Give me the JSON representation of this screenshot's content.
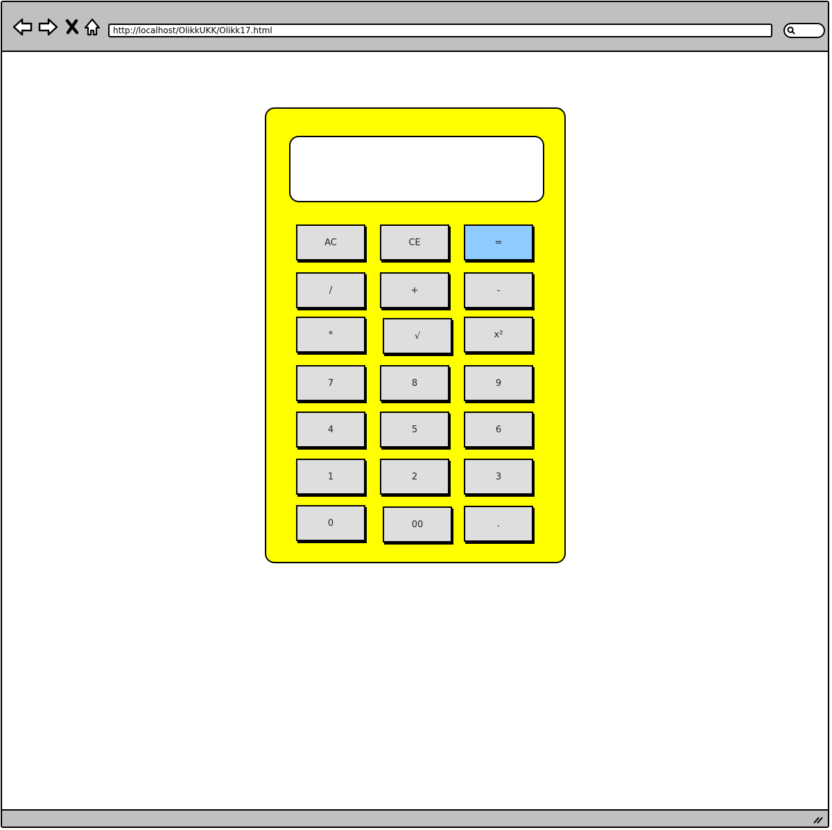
{
  "browser": {
    "url": "http://localhost/OlikkUKK/Olikk17.html",
    "icons": [
      "back-icon",
      "forward-icon",
      "stop-icon",
      "home-icon",
      "search-icon",
      "resize-grip-icon"
    ]
  },
  "calculator": {
    "display_value": "",
    "colors": {
      "body": "#ffff00",
      "key": "#dedede",
      "accent_key": "#8ecbff"
    },
    "keys": [
      "AC",
      "CE",
      "=",
      "/",
      "+",
      "-",
      "*",
      "√",
      "x²",
      "7",
      "8",
      "9",
      "4",
      "5",
      "6",
      "1",
      "2",
      "3",
      "0",
      "00",
      "."
    ]
  }
}
